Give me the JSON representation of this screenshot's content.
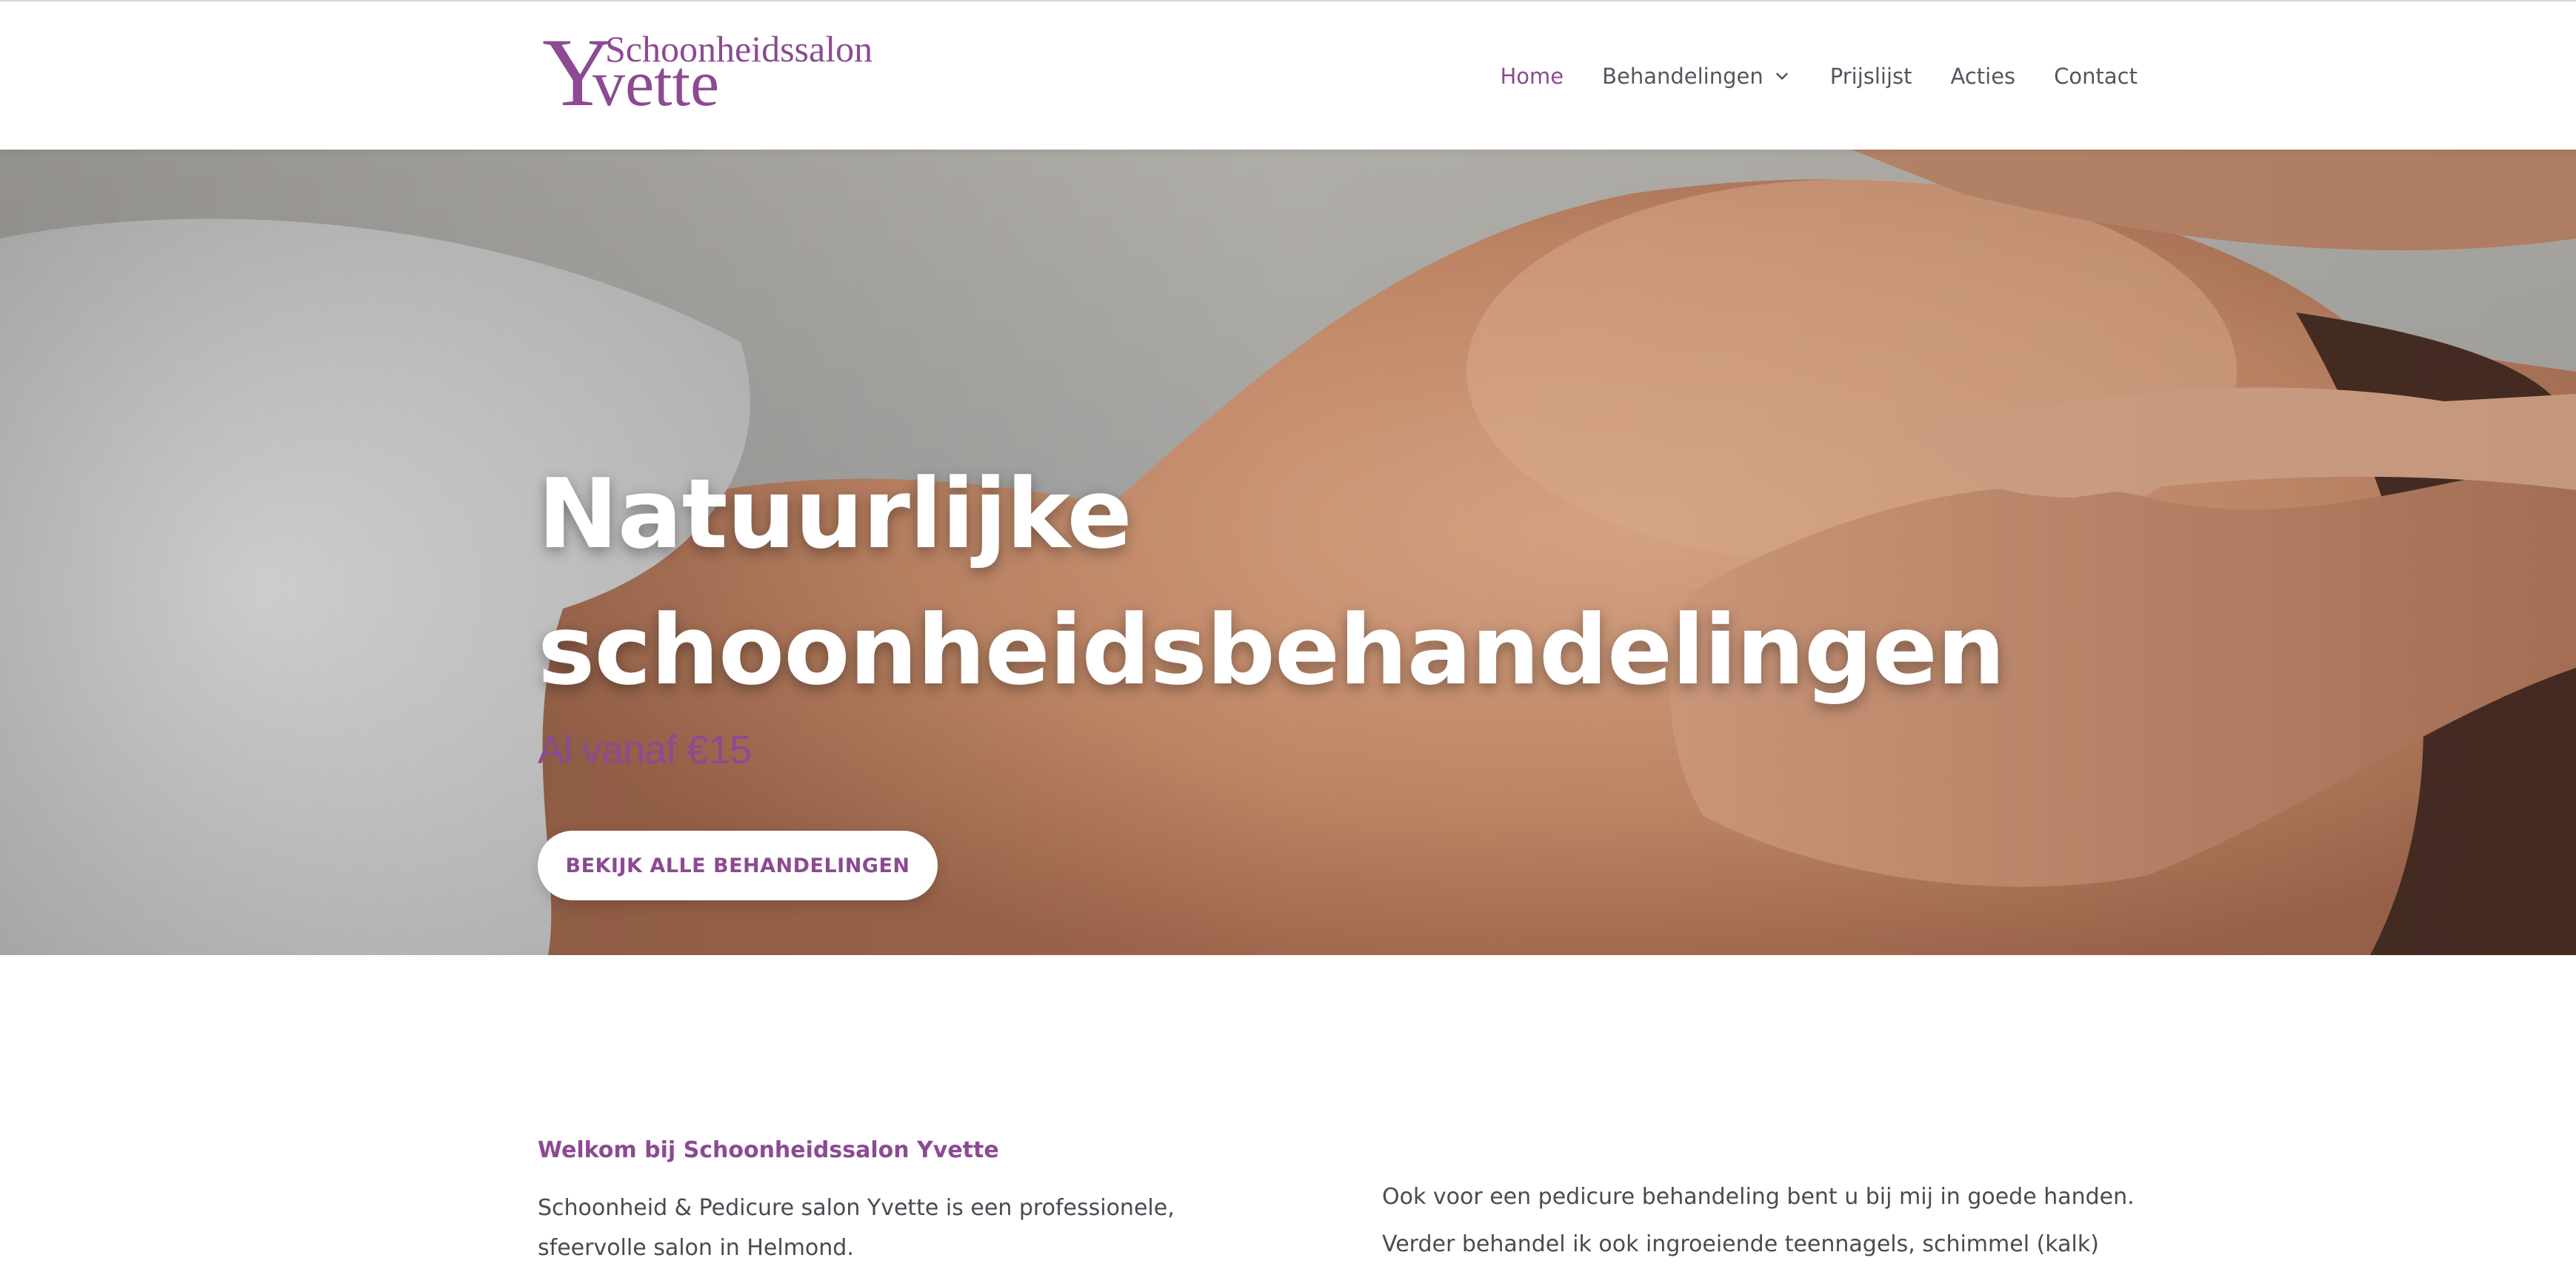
{
  "header": {
    "logo": {
      "big_letter": "Y",
      "top_text": "Schoonheidssalon",
      "bottom_text": "vette"
    },
    "nav": [
      {
        "label": "Home",
        "active": true
      },
      {
        "label": "Behandelingen",
        "has_dropdown": true
      },
      {
        "label": "Prijslijst"
      },
      {
        "label": "Acties"
      },
      {
        "label": "Contact"
      }
    ]
  },
  "hero": {
    "title_line1": "Natuurlijke",
    "title_line2": "schoonheidsbehandelingen",
    "subtitle": "Al vanaf €15",
    "button_label": "BEKIJK ALLE BEHANDELINGEN"
  },
  "intro": {
    "left": {
      "heading": "Welkom bij Schoonheidssalon Yvette",
      "paragraph": "Schoonheid & Pedicure salon Yvette is een professionele, sfeervolle salon in Helmond."
    },
    "right": {
      "paragraph1": "Ook voor een pedicure behandeling bent u bij mij in goede handen.",
      "paragraph2": "Verder behandel ik ook ingroeiende teennagels, schimmel (kalk) nagels,"
    }
  },
  "colors": {
    "brand_purple": "#8c4a93",
    "nav_text": "#555560",
    "body_text": "#4a4a52"
  },
  "icons": {
    "dropdown": "chevron-down-icon"
  }
}
